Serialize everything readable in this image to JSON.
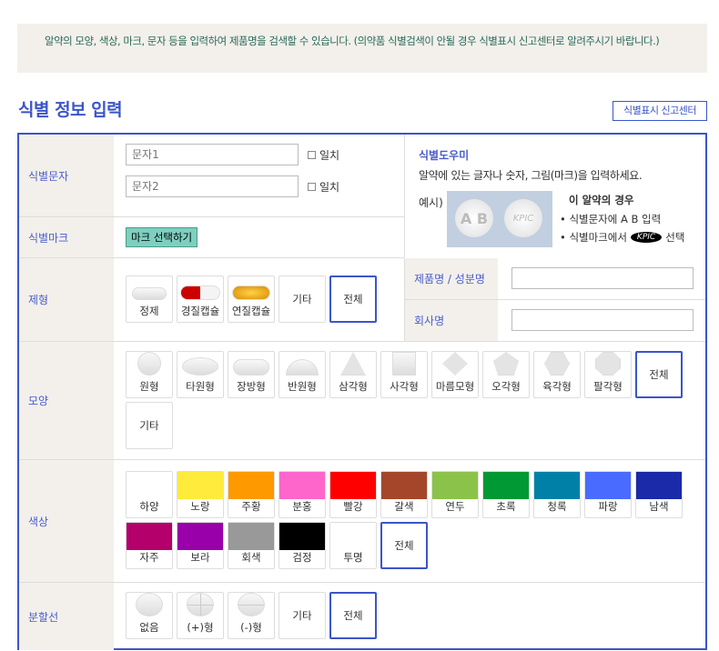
{
  "notice": "알약의 모양, 색상, 마크, 문자 등을 입력하여 제품명을 검색할 수 있습니다. (의약품 식별검색이 안될 경우 식별표시 신고센터로 알려주시기 바랍니다.)",
  "title": "식별 정보 입력",
  "report_button": "식별표시 신고센터",
  "id_text": {
    "label": "식별문자",
    "input1_placeholder": "문자1",
    "input2_placeholder": "문자2",
    "match": "일치"
  },
  "id_mark": {
    "label": "식별마크",
    "button": "마크 선택하기"
  },
  "helper": {
    "title": "식별도우미",
    "desc": "알약에 있는 글자나 숫자, 그림(마크)을 입력하세요.",
    "example": "예시)",
    "case_title": "이 알약의 경우",
    "line1": "• 식별문자에 A B 입력",
    "line2a": "• 식별마크에서",
    "line2b": "선택",
    "logo": "KPIC",
    "pill_text": "A B"
  },
  "form": {
    "label": "제형",
    "items": [
      "정제",
      "경질캡슐",
      "연질캡슐",
      "기타",
      "전체"
    ]
  },
  "product": {
    "label": "제품명 / 성분명",
    "value": ""
  },
  "company": {
    "label": "회사명",
    "value": ""
  },
  "shape": {
    "label": "모양",
    "items": [
      "원형",
      "타원형",
      "장방형",
      "반원형",
      "삼각형",
      "사각형",
      "마름모형",
      "오각형",
      "육각형",
      "팔각형",
      "전체",
      "기타"
    ]
  },
  "color": {
    "label": "색상",
    "items": [
      {
        "name": "하양",
        "hex": "#ffffff"
      },
      {
        "name": "노랑",
        "hex": "#ffeb3b"
      },
      {
        "name": "주황",
        "hex": "#ff9900"
      },
      {
        "name": "분홍",
        "hex": "#ff66cc"
      },
      {
        "name": "빨강",
        "hex": "#ff0000"
      },
      {
        "name": "갈색",
        "hex": "#a5462a"
      },
      {
        "name": "연두",
        "hex": "#8bc34a"
      },
      {
        "name": "초록",
        "hex": "#009933"
      },
      {
        "name": "청록",
        "hex": "#0080a6"
      },
      {
        "name": "파랑",
        "hex": "#4a6bff"
      },
      {
        "name": "남색",
        "hex": "#1a2aa8"
      },
      {
        "name": "자주",
        "hex": "#b3006b"
      },
      {
        "name": "보라",
        "hex": "#9900aa"
      },
      {
        "name": "회색",
        "hex": "#999999"
      },
      {
        "name": "검정",
        "hex": "#000000"
      },
      {
        "name": "투명",
        "hex": ""
      },
      {
        "name": "전체",
        "hex": ""
      }
    ]
  },
  "line": {
    "label": "분할선",
    "items": [
      "없음",
      "(+)형",
      "(-)형",
      "기타",
      "전체"
    ]
  },
  "accent": "#3b55c8"
}
